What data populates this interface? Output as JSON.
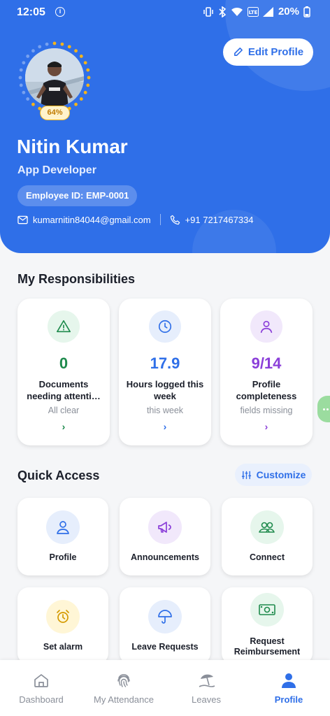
{
  "status_bar": {
    "time": "12:05",
    "battery": "20%"
  },
  "profile": {
    "completion_badge": "64%",
    "completion_fraction": 0.64,
    "name": "Nitin Kumar",
    "role": "App Developer",
    "employee_id": "Employee ID: EMP-0001",
    "email": "kumarnitin84044@gmail.com",
    "phone": "+91 7217467334",
    "edit_label": "Edit Profile"
  },
  "responsibilities": {
    "title": "My Responsibilities",
    "cards": [
      {
        "value": "0",
        "label": "Documents needing attenti…",
        "sub": "All clear",
        "arrow": "›",
        "icon": "warning-icon",
        "color": "#1e8a4c",
        "bg": "#e6f6ec"
      },
      {
        "value": "17.9",
        "label": "Hours logged this week",
        "sub": "this week",
        "arrow": "›",
        "icon": "clock-icon",
        "color": "#2f6fe8",
        "bg": "#e6eefc"
      },
      {
        "value": "9/14",
        "label": "Profile completeness",
        "sub": "fields missing",
        "arrow": "›",
        "icon": "user-icon",
        "color": "#8b3fd9",
        "bg": "#f1e8fb"
      }
    ]
  },
  "quick_access": {
    "title": "Quick Access",
    "customize_label": "Customize",
    "items": [
      {
        "label": "Profile",
        "icon": "user-icon"
      },
      {
        "label": "Announcements",
        "icon": "megaphone-icon"
      },
      {
        "label": "Connect",
        "icon": "users-icon"
      },
      {
        "label": "Set alarm",
        "icon": "alarm-clock-icon"
      },
      {
        "label": "Leave Requests",
        "icon": "umbrella-icon"
      },
      {
        "label": "Request Reimbursement",
        "icon": "cash-icon"
      }
    ]
  },
  "bottom_nav": {
    "items": [
      {
        "label": "Dashboard",
        "icon": "home-icon"
      },
      {
        "label": "My Attendance",
        "icon": "fingerprint-icon"
      },
      {
        "label": "Leaves",
        "icon": "beach-umbrella-icon"
      },
      {
        "label": "Profile",
        "icon": "user-filled-icon",
        "active": true
      }
    ]
  },
  "colors": {
    "primary": "#2f6fe8",
    "accent": "#f4b41a"
  }
}
